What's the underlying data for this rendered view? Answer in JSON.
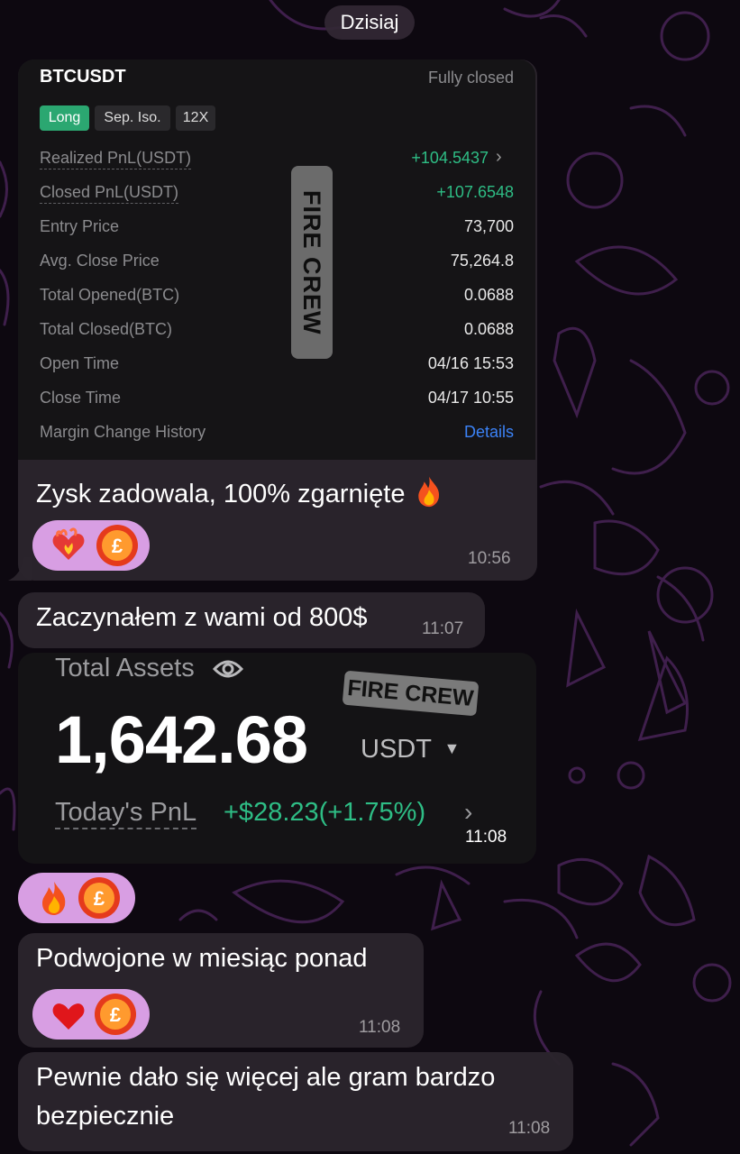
{
  "chat": {
    "date_label": "Dzisiaj"
  },
  "trade_card": {
    "symbol": "BTCUSDT",
    "status": "Fully closed",
    "tags": [
      "Long",
      "Sep. Iso.",
      "12X"
    ],
    "rows": [
      {
        "label": "Realized PnL(USDT)",
        "value": "+104.5437"
      },
      {
        "label": "Closed PnL(USDT)",
        "value": "+107.6548"
      },
      {
        "label": "Entry Price",
        "value": "73,700"
      },
      {
        "label": "Avg. Close Price",
        "value": "75,264.8"
      },
      {
        "label": "Total Opened(BTC)",
        "value": "0.0688"
      },
      {
        "label": "Total Closed(BTC)",
        "value": "0.0688"
      },
      {
        "label": "Open Time",
        "value": "04/16 15:53"
      },
      {
        "label": "Close Time",
        "value": "04/17 10:55"
      },
      {
        "label": "Margin Change History",
        "value": "Details"
      }
    ],
    "watermark": "FIRE CREW"
  },
  "messages": [
    {
      "text": "Zysk zadowala, 100% zgarnięte",
      "time": "10:56"
    },
    {
      "text": "Zaczynałem z wami od 800$",
      "time": "11:07"
    },
    {
      "time": "11:08"
    },
    {
      "text": "Podwojone w miesiąc ponad",
      "time": "11:08"
    },
    {
      "text_line1": "Pewnie dało się więcej ale gram bardzo",
      "text_line2": "bezpiecznie",
      "time": "11:08"
    }
  ],
  "assets_card": {
    "label": "Total Assets",
    "value": "1,642.68",
    "unit": "USDT",
    "pnl_label": "Today's PnL",
    "pnl_value": "+$28.23(+1.75%)",
    "watermark": "FIRE CREW"
  },
  "icons": {
    "fire": "fire-emoji",
    "heart_fire": "heart-on-fire-emoji",
    "heart": "red-heart-emoji",
    "avatar": "coin-avatar",
    "eye": "eye-icon"
  },
  "colors": {
    "accent_green": "#2ebd85",
    "link_blue": "#3b82f6",
    "reaction_pink": "#d89ee3",
    "bubble": "#2a242c"
  }
}
